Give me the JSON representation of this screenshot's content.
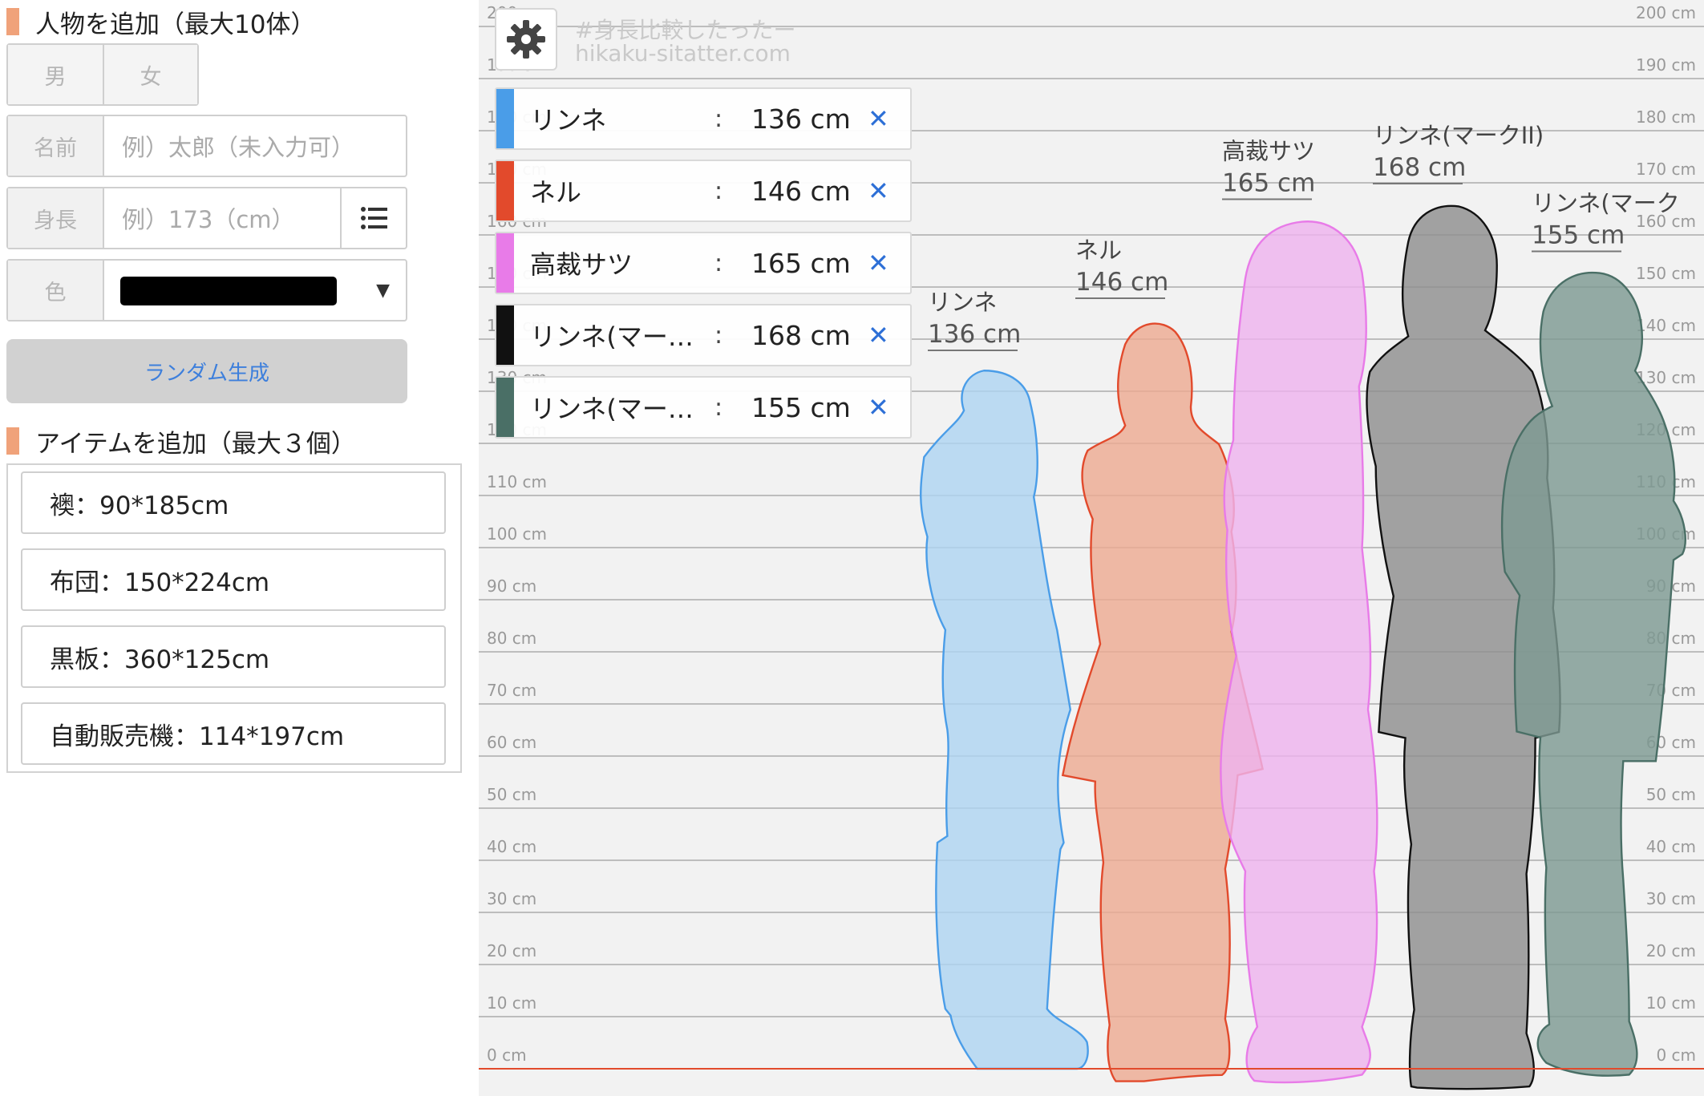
{
  "left_panel": {
    "person_section_title": "人物を追加（最大10体）",
    "gender_male": "男",
    "gender_female": "女",
    "name_label": "名前",
    "name_placeholder": "例）太郎（未入力可）",
    "height_label": "身長",
    "height_placeholder": "例）173（cm）",
    "color_label": "色",
    "color_value": "#000000",
    "random_button": "ランダム生成",
    "item_section_title": "アイテムを追加（最大３個）",
    "items": [
      {
        "label": "襖：90*185cm"
      },
      {
        "label": "布団：150*224cm"
      },
      {
        "label": "黒板：360*125cm"
      },
      {
        "label": "自動販売機：114*197cm"
      }
    ]
  },
  "watermark": {
    "line1": "#身長比較したったー",
    "line2": "hikaku-sitatter.com"
  },
  "person_list": [
    {
      "name": "リンネ",
      "height": "136 cm",
      "color": "#4a9de8"
    },
    {
      "name": "ネル",
      "height": "146 cm",
      "color": "#e24a2c"
    },
    {
      "name": "高裁サツ",
      "height": "165 cm",
      "color": "#e87be8"
    },
    {
      "name": "リンネ(マー…",
      "height": "168 cm",
      "color": "#111111"
    },
    {
      "name": "リンネ(マー…",
      "height": "155 cm",
      "color": "#4a6f66"
    }
  ],
  "chart_data": {
    "type": "height-comparison",
    "unit": "cm",
    "ylim": [
      0,
      200
    ],
    "tick_step": 10,
    "tick_labels": [
      "0 cm",
      "10 cm",
      "20 cm",
      "30 cm",
      "40 cm",
      "50 cm",
      "60 cm",
      "70 cm",
      "80 cm",
      "90 cm",
      "100 cm",
      "110 cm",
      "120 cm",
      "130 cm",
      "140 cm",
      "150 cm",
      "160 cm",
      "170 cm",
      "180 cm",
      "190 cm",
      "200 cm"
    ],
    "figures": [
      {
        "name": "リンネ",
        "height_label": "136 cm",
        "height": 136,
        "fill": "#aed4f2",
        "stroke": "#4a9de8"
      },
      {
        "name": "ネル",
        "height_label": "146 cm",
        "height": 146,
        "fill": "#edab93",
        "stroke": "#e24a2c"
      },
      {
        "name": "高裁サツ",
        "height_label": "165 cm",
        "height": 165,
        "fill": "#eeb3ee",
        "stroke": "#e87be8"
      },
      {
        "name": "リンネ(マークII)",
        "height_label": "168 cm",
        "height": 168,
        "fill": "#8f8f8f",
        "stroke": "#111111"
      },
      {
        "name": "リンネ(マーク",
        "height_label": "155 cm",
        "height": 155,
        "fill": "#7e9a93",
        "stroke": "#4a6f66"
      }
    ],
    "baseline_color": "#e24a2c"
  }
}
